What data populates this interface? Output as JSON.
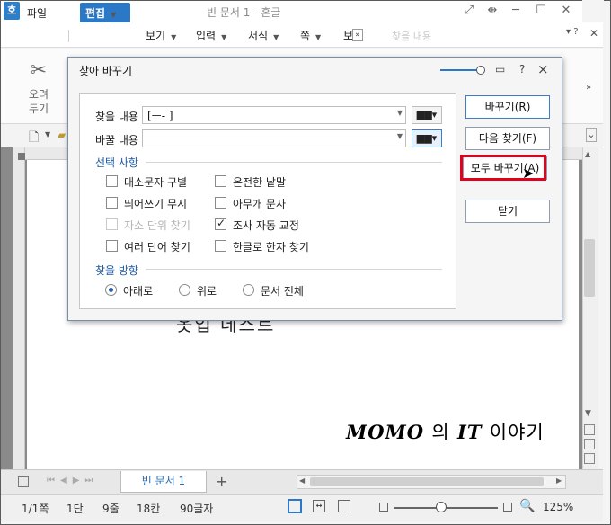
{
  "window": {
    "title": "빈 문서 1 - 혼글",
    "logo": "호"
  },
  "menubar": {
    "file": "파일",
    "edit": "편집",
    "items": [
      "보기",
      "입력",
      "서식",
      "쪽",
      "보"
    ],
    "search_ghost": "찾을 내용"
  },
  "ribbon": {
    "cut_label_line1": "오려",
    "cut_label_line2": "두기"
  },
  "document": {
    "brand_momo": "MOMO",
    "brand_ui": "의",
    "brand_it": "IT",
    "brand_tail": "이야기",
    "partial_text": "옷업  데스트"
  },
  "tabs": {
    "doc_tab": "빈 문서 1",
    "add": "+"
  },
  "status": {
    "page": "1/1쪽",
    "section": "1단",
    "line": "9줄",
    "column": "18칸",
    "chars": "90글자",
    "zoom": "125%"
  },
  "dialog": {
    "title": "찾아 바꾸기",
    "find_label": "찾을 내용",
    "find_value": "[ㅡ-   ]",
    "replace_label": "바꿀 내용",
    "replace_value": "",
    "options_label": "선택 사항",
    "options": {
      "match_case": {
        "label": "대소문자 구별",
        "checked": false
      },
      "whole_word": {
        "label": "온전한 낱말",
        "checked": false
      },
      "ignore_space": {
        "label": "띄어쓰기 무시",
        "checked": false
      },
      "wildcard": {
        "label": "아무개 문자",
        "checked": false
      },
      "syllable": {
        "label": "자소 단위 찾기",
        "checked": false,
        "disabled": true
      },
      "auto_josa": {
        "label": "조사 자동 교정",
        "checked": true
      },
      "multi_word": {
        "label": "여러 단어 찾기",
        "checked": false
      },
      "hanja": {
        "label": "한글로 한자 찾기",
        "checked": false
      }
    },
    "direction_label": "찾을 방향",
    "direction": {
      "down": "아래로",
      "up": "위로",
      "all": "문서 전체",
      "selected": "down"
    },
    "buttons": {
      "replace": "바꾸기(R)",
      "find_next": "다음 찾기(F)",
      "replace_all": "모두 바꾸기(A)",
      "close": "닫기"
    },
    "help": "?",
    "close_x": "×"
  },
  "colors": {
    "accent": "#2b78c7",
    "highlight": "#e3001b"
  }
}
